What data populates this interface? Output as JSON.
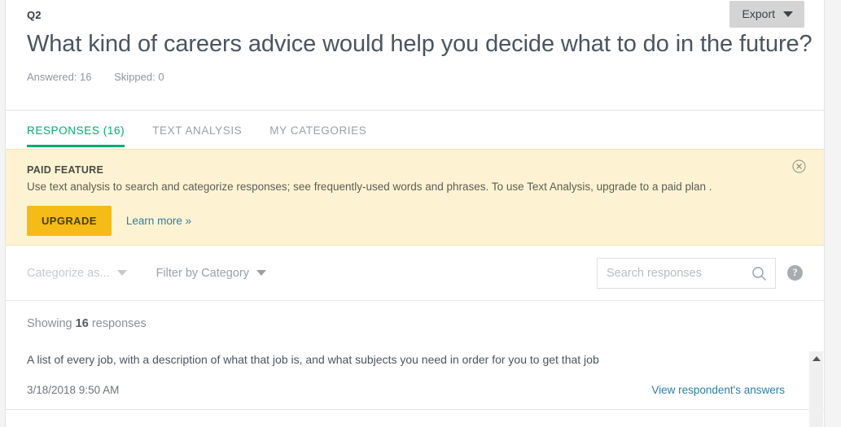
{
  "question": {
    "number": "Q2",
    "title": "What kind of careers advice would help you decide what to do in the future?",
    "answered": "Answered: 16",
    "skipped": "Skipped: 0"
  },
  "export": {
    "label": "Export",
    "caret_icon": "chevron-down-icon"
  },
  "tabs": [
    {
      "label": "RESPONSES (16)",
      "active": true
    },
    {
      "label": "TEXT ANALYSIS",
      "active": false
    },
    {
      "label": "MY CATEGORIES",
      "active": false
    }
  ],
  "banner": {
    "title": "PAID FEATURE",
    "text": "Use text analysis to search and categorize responses; see frequently-used words and phrases. To use Text Analysis, upgrade to a paid plan .",
    "upgrade_label": "UPGRADE",
    "learn_more_label": "Learn more »",
    "close_icon": "close-circle-icon",
    "background_color": "#fdf3d3",
    "upgrade_color": "#f5bb16",
    "link_color": "#2d7fa1"
  },
  "toolbar": {
    "categorize_label": "Categorize as...",
    "filter_label": "Filter by Category",
    "caret_icon": "chevron-down-icon",
    "search_placeholder": "Search responses",
    "search_value": "",
    "search_icon": "search-icon",
    "help_icon": "help-circle-icon",
    "help_label": "?"
  },
  "responses": {
    "showing_prefix": "Showing ",
    "showing_count": "16",
    "showing_suffix": " responses",
    "items": [
      {
        "text": "A list of every job, with a description of what that job is, and what subjects you need in order for you to get that job",
        "date": "3/18/2018 9:50 AM",
        "view_link": "View respondent's answers"
      }
    ]
  },
  "scrollbar": {
    "up_arrow_icon": "arrow-up-icon"
  },
  "theme": {
    "accent_green": "#00ab6c",
    "page_background": "#f4f4f4",
    "card_background": "#ffffff"
  }
}
